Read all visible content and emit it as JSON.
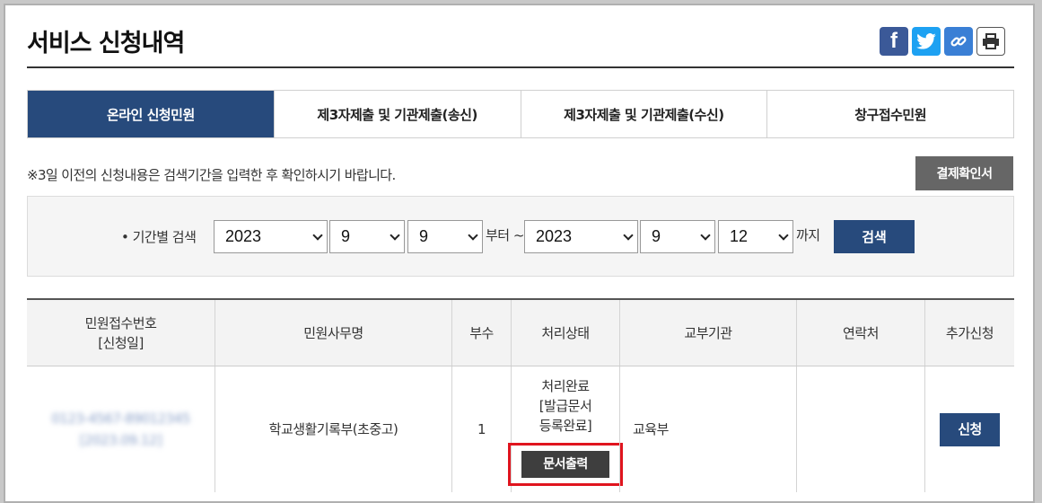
{
  "header": {
    "title": "서비스 신청내역",
    "share_icons": [
      "facebook-icon",
      "twitter-icon",
      "link-icon",
      "print-icon"
    ],
    "share_facebook_glyph": "f"
  },
  "tabs": [
    {
      "label": "온라인 신청민원",
      "active": true
    },
    {
      "label": "제3자제출 및 기관제출(송신)",
      "active": false
    },
    {
      "label": "제3자제출 및 기관제출(수신)",
      "active": false
    },
    {
      "label": "창구접수민원",
      "active": false
    }
  ],
  "notice": "※3일 이전의 신청내용은 검색기간을 입력한 후 확인하시기 바랍니다.",
  "payment_confirm_label": "결제확인서",
  "search": {
    "label": "• 기간별 검색",
    "from_year": "2023",
    "from_month": "9",
    "from_day": "9",
    "from_suffix": "부터 ~",
    "to_year": "2023",
    "to_month": "9",
    "to_day": "12",
    "to_suffix": "까지",
    "button": "검색"
  },
  "table": {
    "headers": [
      "민원접수번호\n[신청일]",
      "민원사무명",
      "부수",
      "처리상태",
      "교부기관",
      "연락처",
      "추가신청"
    ],
    "rows": [
      {
        "receipt_no": "0123-4567-89012345",
        "applied_date": "[2023.09.12]",
        "name": "학교생활기록부(초중고)",
        "copies": "1",
        "status": "처리완료\n[발급문서\n등록완료]",
        "print_label": "문서출력",
        "agency": "교육부",
        "contact": "",
        "apply_label": "신청"
      }
    ]
  },
  "colors": {
    "primary": "#274a7c",
    "highlight": "#e0141e",
    "gray_button": "#666666"
  }
}
